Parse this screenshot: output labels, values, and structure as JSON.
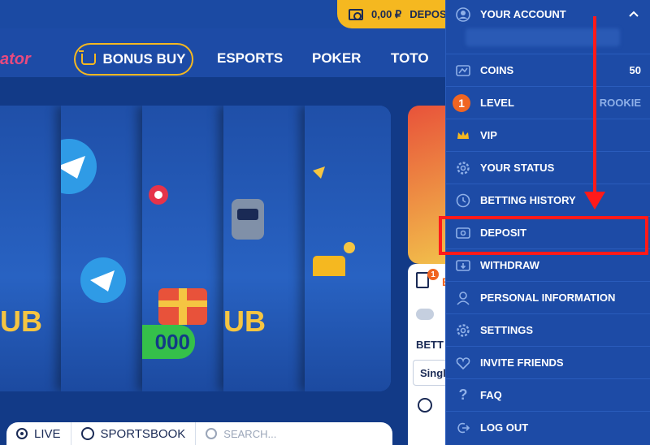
{
  "header": {
    "balance": "0,00 ₽",
    "deposit_label": "DEPOS",
    "logo_text": "ator"
  },
  "nav": {
    "bonus_buy": "BONUS BUY",
    "esports": "ESPORTS",
    "poker": "POKER",
    "toto": "TOTO"
  },
  "hero": {
    "card1_text": "UB",
    "card3_text": "000",
    "card4_text": "UB"
  },
  "betslip": {
    "count": "1",
    "betting_label": "BETT",
    "single_label": "Singl",
    "partial": "E"
  },
  "bottom_bar": {
    "live": "LIVE",
    "sportsbook": "SPORTSBOOK",
    "search_placeholder": "SEARCH..."
  },
  "account_menu": {
    "title": "YOUR ACCOUNT",
    "items": [
      {
        "label": "COINS",
        "value": "50",
        "icon": "coins-icon"
      },
      {
        "label": "LEVEL",
        "value": "ROOKIE",
        "badge": "1",
        "icon": "level-badge"
      },
      {
        "label": "VIP",
        "icon": "crown-icon"
      },
      {
        "label": "YOUR STATUS",
        "icon": "gear-icon"
      },
      {
        "label": "BETTING HISTORY",
        "icon": "clock-icon"
      },
      {
        "label": "DEPOSIT",
        "icon": "deposit-icon"
      },
      {
        "label": "WITHDRAW",
        "icon": "withdraw-icon"
      },
      {
        "label": "PERSONAL INFORMATION",
        "icon": "user-icon"
      },
      {
        "label": "SETTINGS",
        "icon": "settings-icon"
      },
      {
        "label": "INVITE FRIENDS",
        "icon": "heart-icon"
      },
      {
        "label": "FAQ",
        "icon": "question-icon"
      },
      {
        "label": "LOG OUT",
        "icon": "logout-icon"
      }
    ]
  },
  "colors": {
    "accent": "#f5b820",
    "menu_bg": "#1d4ba6",
    "highlight": "#ff1a1a",
    "level_badge": "#f06522"
  }
}
